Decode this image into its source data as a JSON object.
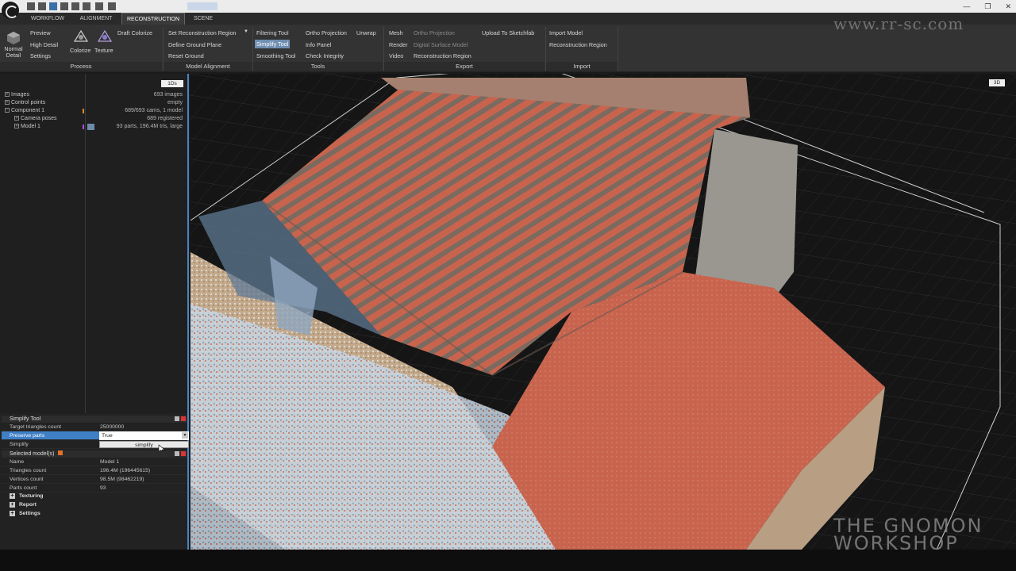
{
  "tabs": [
    "WORKFLOW",
    "ALIGNMENT",
    "RECONSTRUCTION",
    "SCENE"
  ],
  "active_tab": "RECONSTRUCTION",
  "ribbon": {
    "process": {
      "normal_detail": "Normal Detail",
      "preview": "Preview",
      "high_detail": "High Detail",
      "settings": "Settings",
      "colorize": "Colorize",
      "texture": "Texture",
      "draft_colorize": "Draft Colorize",
      "label": "Process"
    },
    "model_alignment": {
      "set_region": "Set Reconstruction Region",
      "define_ground": "Define Ground Plane",
      "reset_ground": "Reset Ground",
      "label": "Model Alignment"
    },
    "tools": {
      "filtering": "Filtering Tool",
      "simplify": "Simplify Tool",
      "smoothing": "Smoothing Tool",
      "ortho": "Ortho Projection",
      "unwrap": "Unwrap",
      "info_panel": "Info Panel",
      "check_integrity": "Check Integrity",
      "label": "Tools"
    },
    "export": {
      "mesh": "Mesh",
      "render": "Render",
      "video": "Video",
      "ortho": "Ortho Projection",
      "dsm": "Digital Surface Model",
      "recon_region": "Reconstruction Region",
      "sketchfab": "Upload To Sketchfab",
      "label": "Export"
    },
    "import": {
      "import_model": "Import Model",
      "recon_region": "Reconstruction Region",
      "label": "Import"
    }
  },
  "tree": {
    "header": "1Ds",
    "rows": [
      {
        "label": "Images",
        "value": "693 images"
      },
      {
        "label": "Control points",
        "value": "empty"
      },
      {
        "label": "Component 1",
        "value": "689/693 cams, 1 model"
      },
      {
        "label": "Camera poses",
        "value": "689 registered"
      },
      {
        "label": "Model 1",
        "value": "93 parts, 196.4M tris, large"
      }
    ]
  },
  "simplify_tool": {
    "title": "Simplify Tool",
    "target_label": "Target triangles count",
    "target_value": "25000000",
    "preserve_label": "Preserve parts",
    "preserve_value": "True",
    "simplify_label": "Simplify",
    "simplify_button": "simplify"
  },
  "selected_models": {
    "title": "Selected model(s)",
    "rows": [
      {
        "key": "Name",
        "value": "Model 1"
      },
      {
        "key": "Triangles count",
        "value": "196.4M (196445615)"
      },
      {
        "key": "Vertices count",
        "value": "98.5M (98462219)"
      },
      {
        "key": "Parts count",
        "value": "93"
      }
    ],
    "sections": [
      "Texturing",
      "Report",
      "Settings"
    ]
  },
  "viewport": {
    "label": "3D",
    "watermark_line1": "THE GNOMON",
    "watermark_line2": "WORKSHOP",
    "url_watermark": "www.rr-sc.com"
  },
  "colors": {
    "accent": "#3f7fc6",
    "roof_red": "#c8644e",
    "wall_tan": "#b59a7a",
    "panel": "#222222"
  }
}
